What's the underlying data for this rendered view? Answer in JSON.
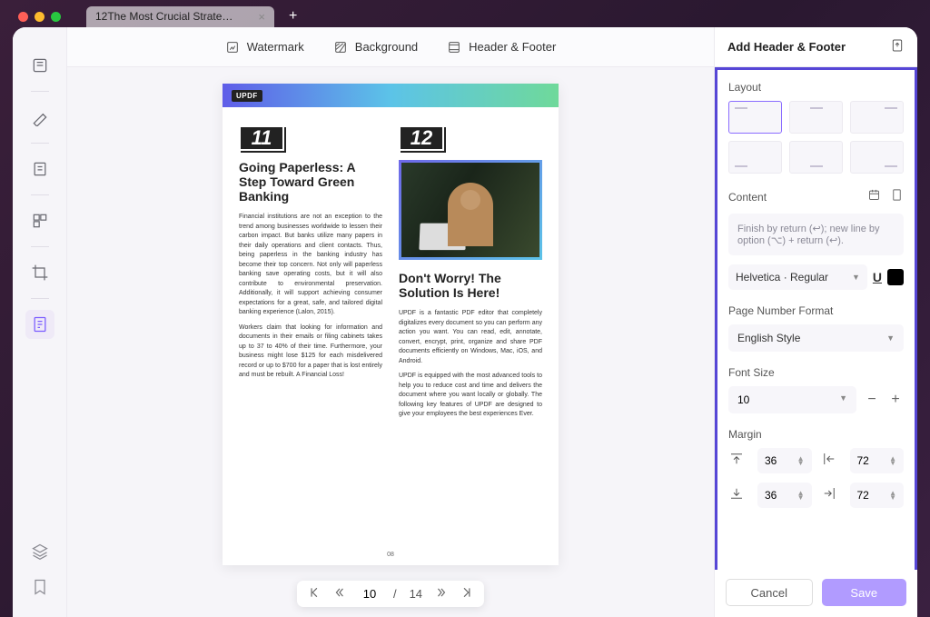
{
  "tab": {
    "title": "12The Most Crucial Strate…"
  },
  "toolbar": {
    "watermark": "Watermark",
    "background": "Background",
    "header_footer": "Header & Footer"
  },
  "document": {
    "brand": "UPDF",
    "left": {
      "number": "11",
      "heading": "Going Paperless: A Step Toward Green Banking",
      "p1": "Financial institutions are not an exception to the trend among businesses worldwide to lessen their carbon impact. But banks utilize many papers in their daily operations and client contacts. Thus, being paperless in the banking industry has become their top concern. Not only will paperless banking save operating costs, but it will also contribute to environmental preservation. Additionally, it will support achieving consumer expectations for a great, safe, and tailored digital banking experience (Lalon, 2015).",
      "p2": "Workers claim that looking for information and documents in their emails or filing cabinets takes up to 37 to 40% of their time. Furthermore, your business might lose $125 for each misdelivered record or up to $700 for a paper that is lost entirely and must be rebuilt. A Financial Loss!"
    },
    "right": {
      "number": "12",
      "heading": "Don't Worry! The Solution Is Here!",
      "p1": "UPDF is a fantastic PDF editor that completely digitalizes every document so you can perform any action you want. You can read, edit, annotate, convert, encrypt, print, organize and share PDF documents efficiently on Windows, Mac, iOS, and Android.",
      "p2": "UPDF is equipped with the most advanced tools to help you to reduce cost and time and delivers the document where you want locally or globally. The following key features of UPDF are designed to give your employees the best experiences Ever."
    },
    "page_number": "08"
  },
  "pager": {
    "current": "10",
    "sep": "/",
    "total": "14"
  },
  "panel": {
    "title": "Add Header & Footer",
    "layout_label": "Layout",
    "content_label": "Content",
    "content_placeholder": "Finish by return (↩); new line by option (⌥) + return (↩).",
    "font": "Helvetica · Regular",
    "pnf_label": "Page Number Format",
    "pnf_value": "English Style",
    "fontsize_label": "Font Size",
    "fontsize_value": "10",
    "margin_label": "Margin",
    "margin_top": "36",
    "margin_left": "72",
    "margin_bottom": "36",
    "margin_right": "72",
    "cancel": "Cancel",
    "save": "Save"
  }
}
